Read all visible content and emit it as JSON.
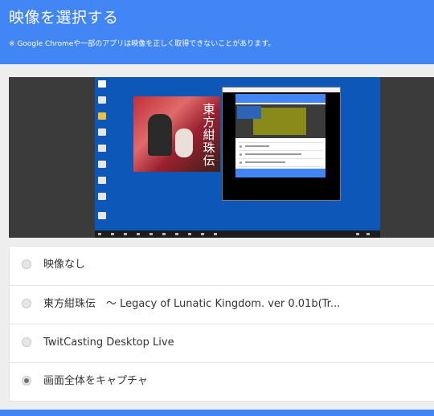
{
  "header": {
    "title": "映像を選択する",
    "note": "※ Google Chromeや一部のアプリは映像を正しく取得できないことがあります。"
  },
  "preview": {
    "description_icon": "desktop-screen-preview",
    "window_title_text": "東方紺珠伝"
  },
  "options": [
    {
      "label": "映像なし",
      "selected": false
    },
    {
      "label": "東方紺珠伝　～ Legacy of Lunatic Kingdom. ver 0.01b(Tr...",
      "selected": false
    },
    {
      "label": "TwitCasting Desktop Live",
      "selected": false
    },
    {
      "label": "画面全体をキャプチャ",
      "selected": true
    }
  ],
  "colors": {
    "accent": "#4285f4",
    "desktop": "#0c57b8"
  }
}
